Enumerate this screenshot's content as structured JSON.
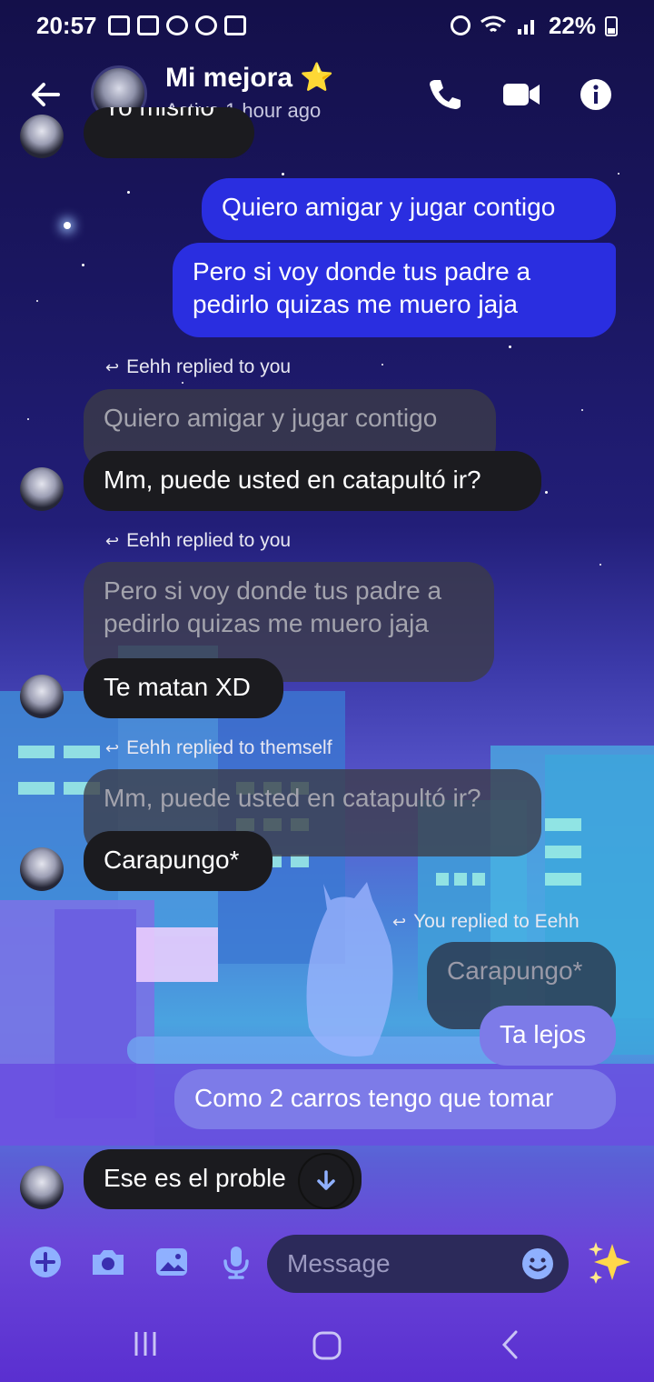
{
  "status_bar": {
    "time": "20:57",
    "battery": "22%"
  },
  "header": {
    "contact_name": "Mi mejora",
    "name_emoji": "⭐",
    "status": "Active 1 hour ago"
  },
  "messages": {
    "cut_off_text": "Yo mismo",
    "out1": "Quiero amigar y jugar contigo",
    "out2": "Pero si voy donde tus padre a pedirlo quizas me muero jaja",
    "reply1_label": "Eehh replied to you",
    "reply1_quote": "Quiero amigar y jugar contigo",
    "reply1_text": "Mm, puede usted en catapultó ir?",
    "reply2_label": "Eehh replied to you",
    "reply2_quote": "Pero si voy donde tus padre a pedirlo quizas me muero jaja",
    "reply2_text": "Te matan XD",
    "reply3_label": "Eehh replied to themself",
    "reply3_quote": "Mm, puede usted en catapultó ir?",
    "reply3_text": "Carapungo*",
    "reply4_label": "You replied to Eehh",
    "reply4_quote": "Carapungo*",
    "reply4_text": "Ta lejos",
    "out3": "Como 2 carros tengo que tomar",
    "last_in": "Ese es el proble"
  },
  "composer": {
    "placeholder": "Message"
  },
  "colors": {
    "outgoing_bubble": "#2a2ee0",
    "incoming_bubble": "#1b1b1f",
    "accent_icon": "#8fb0ff"
  }
}
